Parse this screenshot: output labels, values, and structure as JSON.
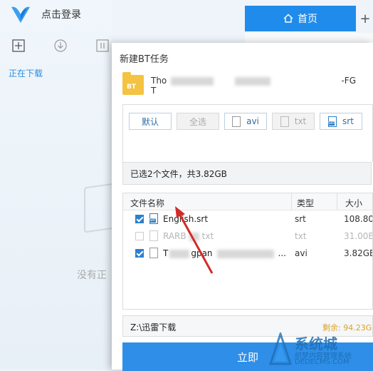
{
  "app": {
    "login_text": "点击登录",
    "downloading_label": "正在下载",
    "empty_text": "没有正"
  },
  "toolbar": {
    "icons": [
      "plus-icon",
      "download-icon",
      "pause-icon",
      "delete-icon",
      "trash-icon"
    ]
  },
  "browser": {
    "home_tab": "首页",
    "add_tab": "+"
  },
  "dialog": {
    "title": "新建BT任务",
    "bt_badge": "BT",
    "task_name_prefix": "Tho",
    "task_name_suffix": "-FG",
    "task_name_line2": "T",
    "filters": {
      "default": "默认",
      "select_all": "全选",
      "avi": "avi",
      "txt": "txt",
      "srt": "srt"
    },
    "summary": "已选2个文件，共3.82GB",
    "table": {
      "col_name": "文件名称",
      "col_type": "类型",
      "col_size": "大小",
      "rows": [
        {
          "name": "English.srt",
          "type": "srt",
          "size": "108.80K",
          "checked": true
        },
        {
          "name": "RARB",
          "name_tail": "txt",
          "type": "txt",
          "size": "31.00B",
          "checked": false
        },
        {
          "name": "T",
          "name_mid": "gpan",
          "name_tail": "...",
          "type": "avi",
          "size": "3.82GB",
          "checked": true
        }
      ]
    },
    "save_path": "Z:\\迅雷下载",
    "remaining": "剩余: 94.23G",
    "start_button": "立即"
  },
  "watermark": {
    "brand": "系统城",
    "subtitle": "织梦内容管理系统",
    "url": "DEDECMS.COM"
  },
  "colors": {
    "accent": "#2e8ee8",
    "remaining": "#e0a020",
    "link": "#2d8ce0"
  }
}
